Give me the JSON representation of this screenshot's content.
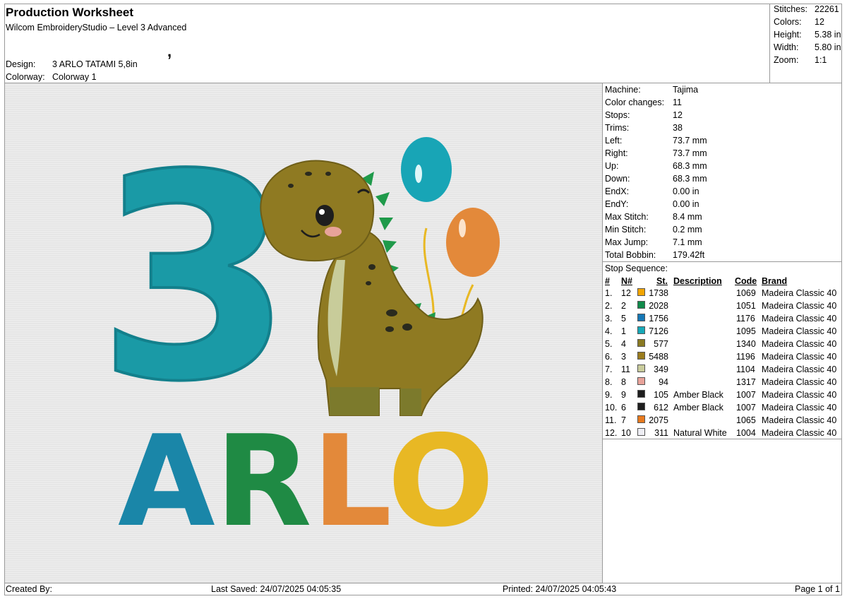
{
  "header": {
    "title": "Production Worksheet",
    "subtitle": "Wilcom EmbroideryStudio – Level 3 Advanced",
    "design_label": "Design:",
    "design_value": "3 ARLO TATAMI 5,8in",
    "colorway_label": "Colorway:",
    "colorway_value": "Colorway 1"
  },
  "stats": [
    {
      "label": "Stitches:",
      "value": "22261"
    },
    {
      "label": "Colors:",
      "value": "12"
    },
    {
      "label": "Height:",
      "value": "5.38 in"
    },
    {
      "label": "Width:",
      "value": "5.80 in"
    },
    {
      "label": "Zoom:",
      "value": "1:1"
    }
  ],
  "machine": [
    {
      "label": "Machine:",
      "value": "Tajima"
    },
    {
      "label": "Color changes:",
      "value": "11"
    },
    {
      "label": "Stops:",
      "value": "12"
    },
    {
      "label": "Trims:",
      "value": "38"
    },
    {
      "label": "Left:",
      "value": "73.7 mm"
    },
    {
      "label": "Right:",
      "value": "73.7 mm"
    },
    {
      "label": "Up:",
      "value": "68.3 mm"
    },
    {
      "label": "Down:",
      "value": "68.3 mm"
    },
    {
      "label": "EndX:",
      "value": "0.00 in"
    },
    {
      "label": "EndY:",
      "value": "0.00 in"
    },
    {
      "label": "Max Stitch:",
      "value": "8.4 mm"
    },
    {
      "label": "Min Stitch:",
      "value": "0.2 mm"
    },
    {
      "label": "Max Jump:",
      "value": "7.1 mm"
    },
    {
      "label": "Total Bobbin:",
      "value": "179.42ft"
    }
  ],
  "stop_sequence": {
    "title": "Stop Sequence:",
    "headers": {
      "num": "#",
      "n": "N#",
      "st": "St.",
      "description": "Description",
      "code": "Code",
      "brand": "Brand"
    },
    "rows": [
      {
        "idx": "1.",
        "n": "12",
        "color": "#f2a500",
        "st": "1738",
        "desc": "",
        "code": "1069",
        "brand": "Madeira Classic 40"
      },
      {
        "idx": "2.",
        "n": "2",
        "color": "#0f8a4a",
        "st": "2028",
        "desc": "",
        "code": "1051",
        "brand": "Madeira Classic 40"
      },
      {
        "idx": "3.",
        "n": "5",
        "color": "#1677b5",
        "st": "1756",
        "desc": "",
        "code": "1176",
        "brand": "Madeira Classic 40"
      },
      {
        "idx": "4.",
        "n": "1",
        "color": "#17a9b8",
        "st": "7126",
        "desc": "",
        "code": "1095",
        "brand": "Madeira Classic 40"
      },
      {
        "idx": "5.",
        "n": "4",
        "color": "#8a7a22",
        "st": "577",
        "desc": "",
        "code": "1340",
        "brand": "Madeira Classic 40"
      },
      {
        "idx": "6.",
        "n": "3",
        "color": "#9a7c1e",
        "st": "5488",
        "desc": "",
        "code": "1196",
        "brand": "Madeira Classic 40"
      },
      {
        "idx": "7.",
        "n": "11",
        "color": "#c9cc9c",
        "st": "349",
        "desc": "",
        "code": "1104",
        "brand": "Madeira Classic 40"
      },
      {
        "idx": "8.",
        "n": "8",
        "color": "#e8a39a",
        "st": "94",
        "desc": "",
        "code": "1317",
        "brand": "Madeira Classic 40"
      },
      {
        "idx": "9.",
        "n": "9",
        "color": "#1e1e1e",
        "st": "105",
        "desc": "Amber Black",
        "code": "1007",
        "brand": "Madeira Classic 40"
      },
      {
        "idx": "10.",
        "n": "6",
        "color": "#1e1e1e",
        "st": "612",
        "desc": "Amber Black",
        "code": "1007",
        "brand": "Madeira Classic 40"
      },
      {
        "idx": "11.",
        "n": "7",
        "color": "#e87a1e",
        "st": "2075",
        "desc": "",
        "code": "1065",
        "brand": "Madeira Classic 40"
      },
      {
        "idx": "12.",
        "n": "10",
        "color": "#eeeef4",
        "st": "311",
        "desc": "Natural White",
        "code": "1004",
        "brand": "Madeira Classic 40"
      }
    ]
  },
  "footer": {
    "created": "Created By:",
    "saved": "Last Saved: 24/07/2025 04:05:35",
    "printed": "Printed: 24/07/2025 04:05:43",
    "page": "Page 1 of 1"
  },
  "design_art": {
    "number": "3",
    "letters": [
      {
        "char": "A",
        "color": "#1a86a8"
      },
      {
        "char": "R",
        "color": "#1f8a44"
      },
      {
        "char": "L",
        "color": "#e3893a"
      },
      {
        "char": "O",
        "color": "#e8b824"
      }
    ]
  }
}
